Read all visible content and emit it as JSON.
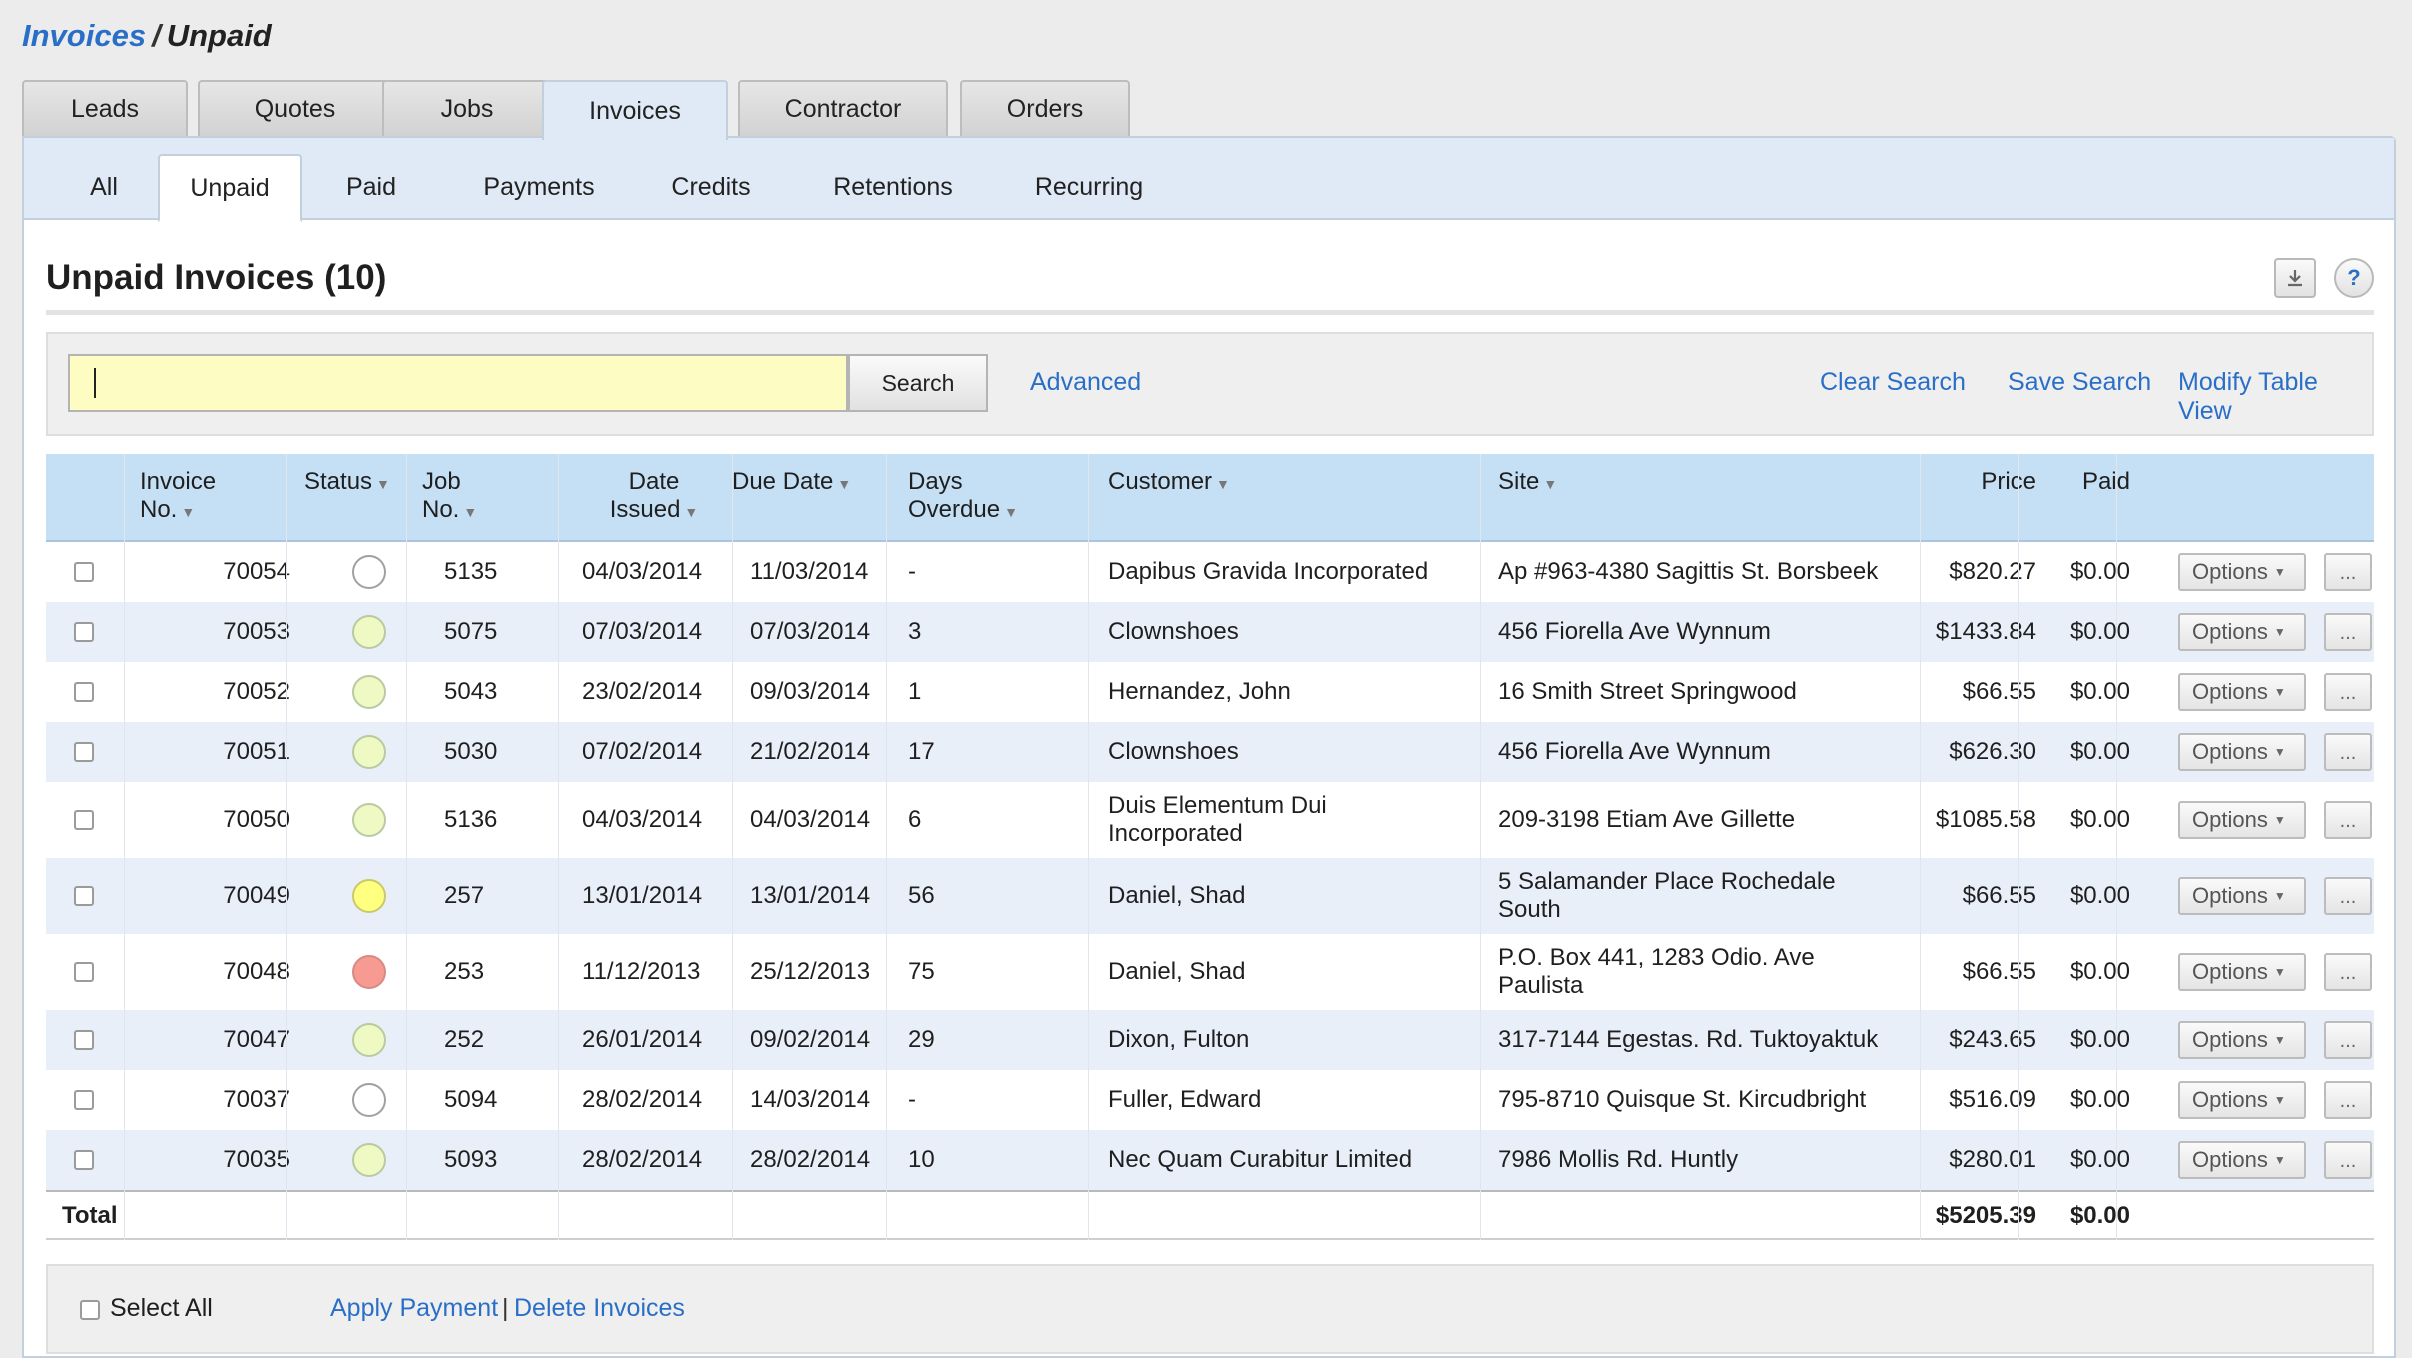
{
  "breadcrumb": {
    "parent": "Invoices",
    "separator": "/",
    "current": "Unpaid"
  },
  "top_tabs": [
    {
      "label": "Leads",
      "active": false
    },
    {
      "label": "Quotes",
      "active": false
    },
    {
      "label": "Jobs",
      "active": false
    },
    {
      "label": "Invoices",
      "active": true
    },
    {
      "label": "Contractor",
      "active": false
    },
    {
      "label": "Orders",
      "active": false
    }
  ],
  "sub_tabs": [
    {
      "label": "All",
      "active": false
    },
    {
      "label": "Unpaid",
      "active": true
    },
    {
      "label": "Paid",
      "active": false
    },
    {
      "label": "Payments",
      "active": false
    },
    {
      "label": "Credits",
      "active": false
    },
    {
      "label": "Retentions",
      "active": false
    },
    {
      "label": "Recurring",
      "active": false
    }
  ],
  "page_title": "Unpaid Invoices (10)",
  "icons": {
    "download": "download-icon",
    "help": "help-icon",
    "help_glyph": "?"
  },
  "search": {
    "value": "",
    "button_label": "Search",
    "advanced_label": "Advanced",
    "clear_label": "Clear Search",
    "save_label": "Save Search",
    "modify_label": "Modify Table View"
  },
  "columns": {
    "invoice_no": [
      "Invoice",
      "No."
    ],
    "status": "Status",
    "job_no": [
      "Job",
      "No."
    ],
    "date_issued": [
      "Date",
      "Issued"
    ],
    "due_date": "Due Date",
    "days_overdue": [
      "Days",
      "Overdue"
    ],
    "customer": "Customer",
    "site": "Site",
    "price": "Price",
    "paid": "Paid"
  },
  "status_colors": {
    "none": "#ffffff",
    "green": "#eef9c4",
    "yellow": "#ffff80",
    "red": "#f79a92"
  },
  "rows": [
    {
      "invoice": "70054",
      "status": "none",
      "job": "5135",
      "issued": "04/03/2014",
      "due": "11/03/2014",
      "overdue": "-",
      "customer": [
        "Dapibus Gravida Incorporated"
      ],
      "site": [
        "Ap #963-4380 Sagittis St. Borsbeek"
      ],
      "price": "$820.27",
      "paid": "$0.00"
    },
    {
      "invoice": "70053",
      "status": "green",
      "job": "5075",
      "issued": "07/03/2014",
      "due": "07/03/2014",
      "overdue": "3",
      "customer": [
        "Clownshoes"
      ],
      "site": [
        "456 Fiorella Ave Wynnum"
      ],
      "price": "$1433.84",
      "paid": "$0.00"
    },
    {
      "invoice": "70052",
      "status": "green",
      "job": "5043",
      "issued": "23/02/2014",
      "due": "09/03/2014",
      "overdue": "1",
      "customer": [
        "Hernandez, John"
      ],
      "site": [
        "16 Smith Street Springwood"
      ],
      "price": "$66.55",
      "paid": "$0.00"
    },
    {
      "invoice": "70051",
      "status": "green",
      "job": "5030",
      "issued": "07/02/2014",
      "due": "21/02/2014",
      "overdue": "17",
      "customer": [
        "Clownshoes"
      ],
      "site": [
        "456 Fiorella Ave Wynnum"
      ],
      "price": "$626.30",
      "paid": "$0.00"
    },
    {
      "invoice": "70050",
      "status": "green",
      "job": "5136",
      "issued": "04/03/2014",
      "due": "04/03/2014",
      "overdue": "6",
      "customer": [
        "Duis Elementum Dui",
        "Incorporated"
      ],
      "site": [
        "209-3198 Etiam Ave Gillette"
      ],
      "price": "$1085.58",
      "paid": "$0.00"
    },
    {
      "invoice": "70049",
      "status": "yellow",
      "job": "257",
      "issued": "13/01/2014",
      "due": "13/01/2014",
      "overdue": "56",
      "customer": [
        "Daniel, Shad"
      ],
      "site": [
        "5 Salamander Place Rochedale",
        "South"
      ],
      "price": "$66.55",
      "paid": "$0.00"
    },
    {
      "invoice": "70048",
      "status": "red",
      "job": "253",
      "issued": "11/12/2013",
      "due": "25/12/2013",
      "overdue": "75",
      "customer": [
        "Daniel, Shad"
      ],
      "site": [
        "P.O. Box 441, 1283 Odio. Ave",
        "Paulista"
      ],
      "price": "$66.55",
      "paid": "$0.00"
    },
    {
      "invoice": "70047",
      "status": "green",
      "job": "252",
      "issued": "26/01/2014",
      "due": "09/02/2014",
      "overdue": "29",
      "customer": [
        "Dixon, Fulton"
      ],
      "site": [
        "317-7144 Egestas. Rd. Tuktoyaktuk"
      ],
      "price": "$243.65",
      "paid": "$0.00"
    },
    {
      "invoice": "70037",
      "status": "none",
      "job": "5094",
      "issued": "28/02/2014",
      "due": "14/03/2014",
      "overdue": "-",
      "customer": [
        "Fuller, Edward"
      ],
      "site": [
        "795-8710 Quisque St. Kircudbright"
      ],
      "price": "$516.09",
      "paid": "$0.00"
    },
    {
      "invoice": "70035",
      "status": "green",
      "job": "5093",
      "issued": "28/02/2014",
      "due": "28/02/2014",
      "overdue": "10",
      "customer": [
        "Nec Quam Curabitur Limited"
      ],
      "site": [
        "7986 Mollis Rd. Huntly"
      ],
      "price": "$280.01",
      "paid": "$0.00"
    }
  ],
  "row_actions": {
    "options_label": "Options",
    "more_label": "..."
  },
  "total": {
    "label": "Total",
    "price": "$5205.39",
    "paid": "$0.00"
  },
  "footer": {
    "select_all": "Select All",
    "apply_payment": "Apply Payment",
    "divider": "|",
    "delete_invoices": "Delete Invoices"
  }
}
